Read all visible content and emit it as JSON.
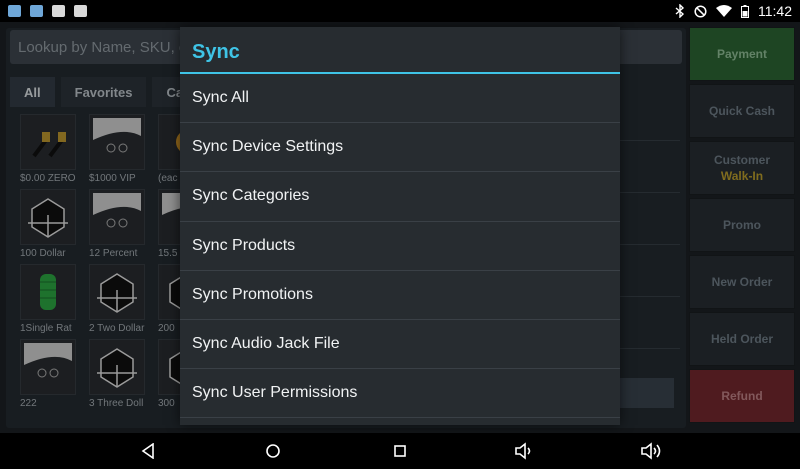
{
  "status_bar": {
    "time": "11:42",
    "left_icons": [
      "app-notification-icon",
      "image-notification-icon",
      "gallery-notification-icon",
      "briefcase-notification-icon"
    ],
    "right_icons": [
      "bluetooth-icon",
      "do-not-disturb-icon",
      "wifi-icon",
      "battery-icon"
    ]
  },
  "search": {
    "placeholder": "Lookup by Name, SKU, e"
  },
  "tabs": [
    {
      "label": "All"
    },
    {
      "label": "Favorites"
    },
    {
      "label": "Ca"
    }
  ],
  "products": [
    {
      "label": "$0.00 ZERO",
      "icon": "cable-icon"
    },
    {
      "label": "$1000 VIP",
      "icon": "placeholder-face-icon"
    },
    {
      "label": "(eac",
      "icon": "coin-icon"
    },
    {
      "label": "100 Dollar",
      "icon": "box-icon"
    },
    {
      "label": "12 Percent",
      "icon": "placeholder-face-icon"
    },
    {
      "label": "15.5",
      "icon": "placeholder-face-icon"
    },
    {
      "label": "1Single Rat",
      "icon": "spool-icon"
    },
    {
      "label": "2 Two Dollar",
      "icon": "box-icon"
    },
    {
      "label": "200",
      "icon": "box-icon"
    },
    {
      "label": "222",
      "icon": "placeholder-face-icon"
    },
    {
      "label": "3 Three Doll",
      "icon": "box-icon"
    },
    {
      "label": "300",
      "icon": "box-icon"
    }
  ],
  "right_buttons": {
    "payment": "Payment",
    "quick_cash": "Quick Cash",
    "customer": "Customer",
    "customer_value": "Walk-In",
    "promo": "Promo",
    "new_order": "New Order",
    "held_order": "Held Order",
    "refund": "Refund"
  },
  "dialog": {
    "title": "Sync",
    "items": [
      "Sync All",
      "Sync Device Settings",
      "Sync Categories",
      "Sync Products",
      "Sync Promotions",
      "Sync Audio Jack File",
      "Sync User Permissions"
    ]
  },
  "nav_bar": {
    "icons": [
      "back-icon",
      "home-icon",
      "recents-icon",
      "volume-down-icon",
      "volume-up-icon"
    ]
  },
  "colors": {
    "accent": "#3fc4e6",
    "payment_green": "#2f6b36",
    "refund_red": "#7a2a30",
    "walk_in_yellow": "#c5a72f"
  }
}
